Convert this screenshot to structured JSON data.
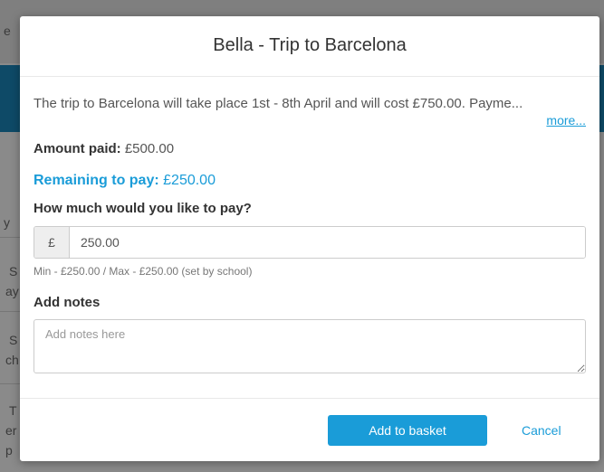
{
  "modal": {
    "title": "Bella - Trip to Barcelona",
    "description": "The trip to Barcelona will take place 1st - 8th April and will cost £750.00. Payme...",
    "more_link": "more...",
    "amount_paid_label": "Amount paid:",
    "amount_paid_value": "£500.00",
    "remaining_label": "Remaining to pay:",
    "remaining_value": "£250.00",
    "question": "How much would you like to pay?",
    "currency_symbol": "£",
    "amount_value": "250.00",
    "helper_text": "Min - £250.00 / Max - £250.00 (set by school)",
    "notes_label": "Add notes",
    "notes_placeholder": "Add notes here",
    "add_button": "Add to basket",
    "cancel_button": "Cancel"
  },
  "background": {
    "fragments": [
      "e",
      "y",
      "S",
      "ay",
      "S",
      "ch",
      "T",
      "er",
      "p"
    ]
  },
  "colors": {
    "accent": "#1a9cd8",
    "background_bar": "#0e4a67"
  }
}
